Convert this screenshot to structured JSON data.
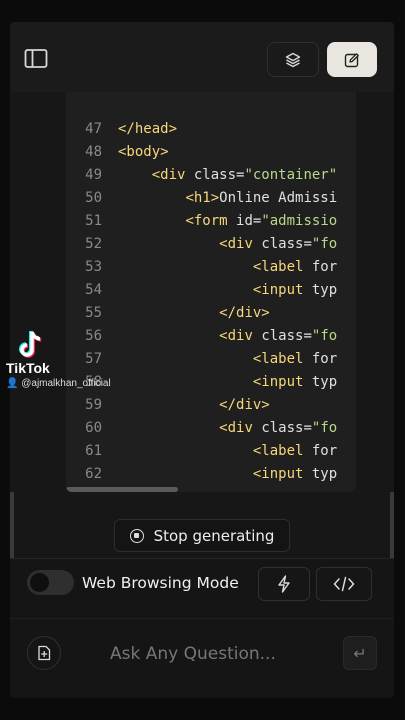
{
  "toolbar": {
    "sidebar_icon": "sidebar-toggle-icon",
    "layers_icon": "layers-icon",
    "edit_icon": "edit-icon"
  },
  "code": {
    "lines": [
      {
        "n": "47",
        "indent": "",
        "parts": [
          [
            "tag",
            "</head>"
          ]
        ]
      },
      {
        "n": "48",
        "indent": "",
        "parts": [
          [
            "tag",
            "<body>"
          ]
        ]
      },
      {
        "n": "49",
        "indent": "    ",
        "parts": [
          [
            "tag",
            "<div "
          ],
          [
            "attr",
            "class="
          ],
          [
            "str",
            "\"container\""
          ]
        ]
      },
      {
        "n": "50",
        "indent": "        ",
        "parts": [
          [
            "tag",
            "<h1>"
          ],
          [
            "attr",
            "Online Admissi"
          ]
        ]
      },
      {
        "n": "51",
        "indent": "        ",
        "parts": [
          [
            "tag",
            "<form "
          ],
          [
            "attr",
            "id="
          ],
          [
            "str",
            "\"admissio"
          ]
        ]
      },
      {
        "n": "52",
        "indent": "            ",
        "parts": [
          [
            "tag",
            "<div "
          ],
          [
            "attr",
            "class="
          ],
          [
            "str",
            "\"fo"
          ]
        ]
      },
      {
        "n": "53",
        "indent": "                ",
        "parts": [
          [
            "tag",
            "<label "
          ],
          [
            "attr",
            "for"
          ]
        ]
      },
      {
        "n": "54",
        "indent": "                ",
        "parts": [
          [
            "tag",
            "<input "
          ],
          [
            "attr",
            "typ"
          ]
        ]
      },
      {
        "n": "55",
        "indent": "            ",
        "parts": [
          [
            "tag",
            "</div>"
          ]
        ]
      },
      {
        "n": "56",
        "indent": "            ",
        "parts": [
          [
            "tag",
            "<div "
          ],
          [
            "attr",
            "class="
          ],
          [
            "str",
            "\"fo"
          ]
        ]
      },
      {
        "n": "57",
        "indent": "                ",
        "parts": [
          [
            "tag",
            "<label "
          ],
          [
            "attr",
            "for"
          ]
        ]
      },
      {
        "n": "58",
        "indent": "                ",
        "parts": [
          [
            "tag",
            "<input "
          ],
          [
            "attr",
            "typ"
          ]
        ]
      },
      {
        "n": "59",
        "indent": "            ",
        "parts": [
          [
            "tag",
            "</div>"
          ]
        ]
      },
      {
        "n": "60",
        "indent": "            ",
        "parts": [
          [
            "tag",
            "<div "
          ],
          [
            "attr",
            "class="
          ],
          [
            "str",
            "\"fo"
          ]
        ]
      },
      {
        "n": "61",
        "indent": "                ",
        "parts": [
          [
            "tag",
            "<label "
          ],
          [
            "attr",
            "for"
          ]
        ]
      },
      {
        "n": "62",
        "indent": "                ",
        "parts": [
          [
            "tag",
            "<input "
          ],
          [
            "attr",
            "typ"
          ]
        ]
      }
    ]
  },
  "stop_button": {
    "label": "Stop generating",
    "icon": "stop-circle-icon"
  },
  "web_browsing": {
    "label": "Web Browsing Mode",
    "enabled": false
  },
  "actions": {
    "bolt_icon": "lightning-icon",
    "code_icon": "code-brackets-icon"
  },
  "input": {
    "placeholder": "Ask Any Question...",
    "value": "",
    "attach_icon": "attach-file-icon",
    "send_icon": "send-return-icon"
  },
  "watermark": {
    "brand": "TikTok",
    "handle": "@ajmalkhan_official"
  },
  "colors": {
    "background": "#171717",
    "tag": "#f7d77a",
    "string": "#b8d98a",
    "accent_button": "#e9e6df"
  }
}
